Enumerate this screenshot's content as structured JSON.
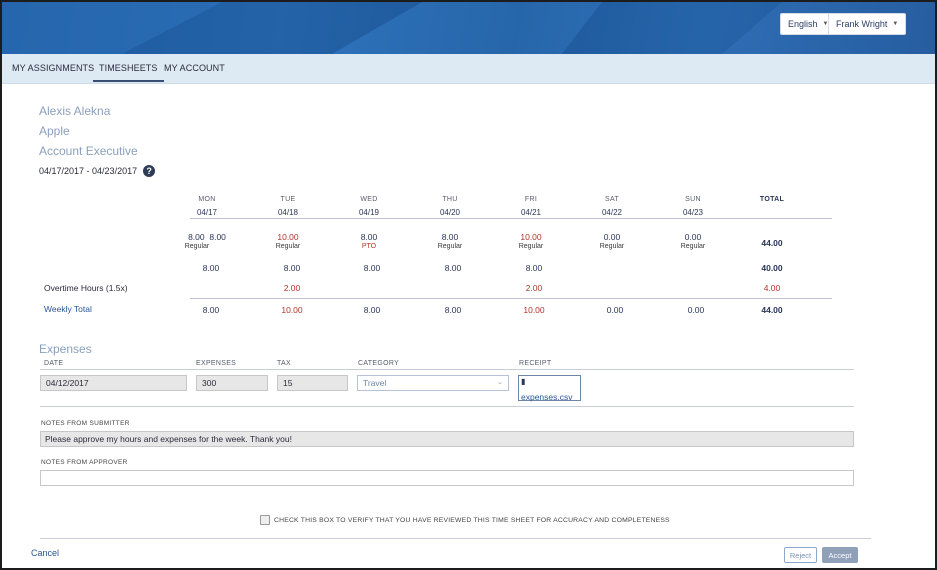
{
  "header": {
    "language": "English",
    "user": "Frank Wright"
  },
  "nav": {
    "tabs": [
      {
        "label": "MY ASSIGNMENTS",
        "active": false
      },
      {
        "label": "TIMESHEETS",
        "active": true
      },
      {
        "label": "MY ACCOUNT",
        "active": false
      }
    ]
  },
  "worker": {
    "name": "Alexis Alekna",
    "company": "Apple",
    "title": "Account Executive",
    "date_range": "04/17/2017 - 04/23/2017"
  },
  "timesheet": {
    "days": [
      {
        "day": "MON",
        "date": "04/17",
        "regular_primary": "8.00",
        "regular_extra": "8.00",
        "regular_type": "Regular",
        "row2": "8.00",
        "overtime": "",
        "weekly": "8.00"
      },
      {
        "day": "TUE",
        "date": "04/18",
        "regular_primary": "10.00",
        "regular_extra": "",
        "regular_type": "Regular",
        "row2": "8.00",
        "overtime": "2.00",
        "weekly": "10.00"
      },
      {
        "day": "WED",
        "date": "04/19",
        "regular_primary": "8.00",
        "regular_extra": "",
        "regular_type": "PTO",
        "row2": "8.00",
        "overtime": "",
        "weekly": "8.00"
      },
      {
        "day": "THU",
        "date": "04/20",
        "regular_primary": "8.00",
        "regular_extra": "",
        "regular_type": "Regular",
        "row2": "8.00",
        "overtime": "",
        "weekly": "8.00"
      },
      {
        "day": "FRI",
        "date": "04/21",
        "regular_primary": "10.00",
        "regular_extra": "",
        "regular_type": "Regular",
        "row2": "8.00",
        "overtime": "2.00",
        "weekly": "10.00"
      },
      {
        "day": "SAT",
        "date": "04/22",
        "regular_primary": "0.00",
        "regular_extra": "",
        "regular_type": "Regular",
        "row2": "",
        "overtime": "",
        "weekly": "0.00"
      },
      {
        "day": "SUN",
        "date": "04/23",
        "regular_primary": "0.00",
        "regular_extra": "",
        "regular_type": "Regular",
        "row2": "",
        "overtime": "",
        "weekly": "0.00"
      }
    ],
    "total_header": "TOTAL",
    "totals": {
      "regular": "44.00",
      "row2": "40.00",
      "overtime": "4.00",
      "weekly": "44.00"
    },
    "overtime_label": "Overtime Hours (1.5x)",
    "weekly_label": "Weekly Total"
  },
  "expenses": {
    "title": "Expenses",
    "headers": {
      "date": "DATE",
      "expenses": "EXPENSES",
      "tax": "TAX",
      "category": "CATEGORY",
      "receipt": "RECEIPT"
    },
    "row": {
      "date": "04/12/2017",
      "expenses": "300",
      "tax": "15",
      "category": "Travel",
      "receipt": "expenses.csv"
    }
  },
  "notes": {
    "submitter_label": "NOTES FROM SUBMITTER",
    "submitter_text": "Please approve my hours and expenses for the week.  Thank you!",
    "approver_label": "NOTES FROM APPROVER",
    "approver_text": ""
  },
  "verify_text": "CHECK THIS BOX TO VERIFY THAT YOU HAVE REVIEWED THIS TIME SHEET FOR ACCURACY AND COMPLETENESS",
  "actions": {
    "cancel": "Cancel",
    "reject": "Reject",
    "accept": "Accept"
  },
  "colors": {
    "accent": "#2a5596",
    "overtime": "#b3352b",
    "banner": "#1f5fa6"
  }
}
